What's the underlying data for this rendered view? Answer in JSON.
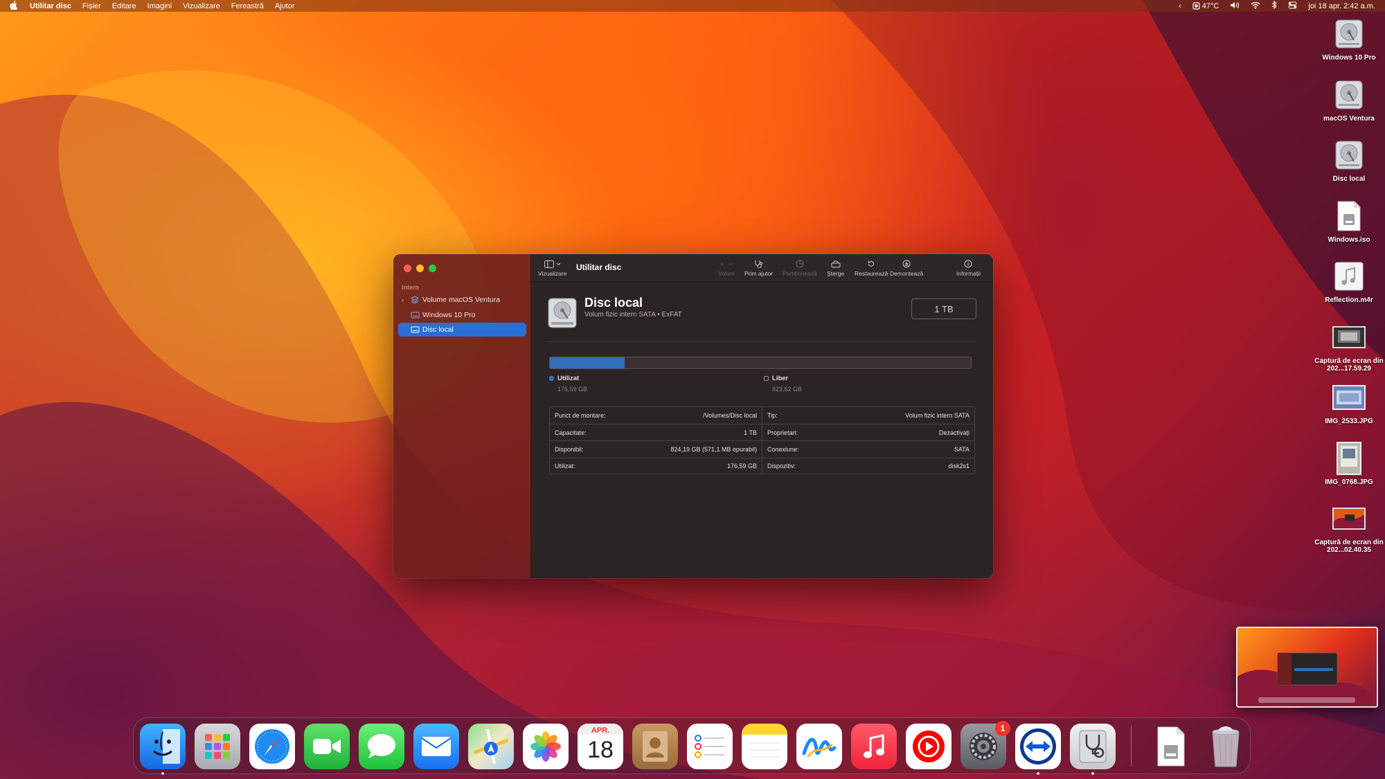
{
  "menubar": {
    "app_name": "Utilitar disc",
    "items": [
      "Fișier",
      "Editare",
      "Imagini",
      "Vizualizare",
      "Fereastră",
      "Ajutor"
    ],
    "temperature": "47°C",
    "datetime": "joi 18 apr.  2:42 a.m."
  },
  "desktop_icons": [
    {
      "label": "Windows 10 Pro",
      "icon": "hard-drive-icon"
    },
    {
      "label": "macOS Ventura",
      "icon": "hard-drive-icon"
    },
    {
      "label": "Disc local",
      "icon": "hard-drive-icon"
    },
    {
      "label": "Windows.iso",
      "icon": "disk-image-icon"
    },
    {
      "label": "Reflection.m4r",
      "icon": "music-file-icon"
    },
    {
      "label": "Captură de ecran din 202...17.59.29",
      "icon": "screenshot-icon"
    },
    {
      "label": "IMG_2533.JPG",
      "icon": "photo-icon"
    },
    {
      "label": "IMG_0768.JPG",
      "icon": "photo-icon"
    },
    {
      "label": "Captură de ecran din 202...02.40.35",
      "icon": "screenshot-icon"
    }
  ],
  "window": {
    "title": "Utilitar disc",
    "sidebar": {
      "section": "Intern",
      "items": [
        {
          "label": "Volume macOS Ventura",
          "selected": false
        },
        {
          "label": "Windows 10 Pro",
          "selected": false
        },
        {
          "label": "Disc local",
          "selected": true
        }
      ]
    },
    "toolbar": {
      "view": "Vizualizare",
      "volume": "Volum",
      "first_aid": "Prim ajutor",
      "partition": "Partiționează",
      "erase": "Șterge",
      "restore": "Restaurează",
      "unmount": "Demontează",
      "info": "Informații"
    },
    "disk": {
      "name": "Disc local",
      "subtitle": "Volum fizic intern SATA • ExFAT",
      "size": "1 TB",
      "used_fraction": 0.177,
      "used_label": "Utilizat",
      "used_value": "176,59 GB",
      "free_label": "Liber",
      "free_value": "823,62 GB"
    },
    "info_left": [
      {
        "k": "Punct de montare:",
        "v": "/Volumes/Disc local"
      },
      {
        "k": "Capacitate:",
        "v": "1 TB"
      },
      {
        "k": "Disponibil:",
        "v": "824,19 GB (571,1 MB epurabil)"
      },
      {
        "k": "Utilizat:",
        "v": "176,59 GB"
      }
    ],
    "info_right": [
      {
        "k": "Tip:",
        "v": "Volum fizic intern SATA"
      },
      {
        "k": "Proprietari:",
        "v": "Dezactivați"
      },
      {
        "k": "Conexiune:",
        "v": "SATA"
      },
      {
        "k": "Dispozitiv:",
        "v": "disk2s1"
      }
    ]
  },
  "dock": {
    "calendar_month": "APR.",
    "calendar_day": "18",
    "settings_badge": "1"
  },
  "colors": {
    "accent": "#2a6fd6",
    "used_bar": "#2f6fb8"
  }
}
